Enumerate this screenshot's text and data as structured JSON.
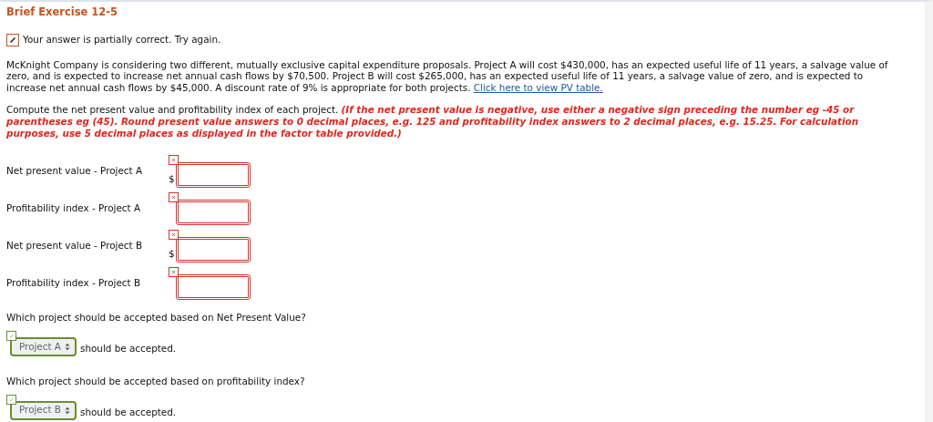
{
  "title": "Brief Exercise 12-5",
  "feedback": {
    "partial": true,
    "text": "Your answer is partially correct.  Try again."
  },
  "problem": {
    "text": "McKnight Company is considering two different, mutually exclusive capital expenditure proposals. Project A will cost $430,000, has an expected useful life of 11 years, a salvage value of zero, and is expected to increase net annual cash flows by $70,500. Project B will cost $265,000, has an expected useful life of 11 years, a salvage value of zero, and is expected to increase net annual cash flows by $45,000. A discount rate of 9% is appropriate for both projects.",
    "link": "Click here to view PV table."
  },
  "instruction": {
    "text": "Compute the net present value and profitability index of each project.",
    "note": "(If the net present value is negative, use either a negative sign preceding the number eg -45 or parentheses eg (45). Round present value answers to 0 decimal places, e.g. 125 and profitability index answers to 2 decimal places, e.g. 15.25. For calculation purposes, use 5 decimal places as displayed in the factor table provided.)"
  },
  "fields": [
    {
      "label": "Net present value - Project A",
      "prefix": "$",
      "correct": false
    },
    {
      "label": "Profitability index - Project A",
      "correct": false
    },
    {
      "label": "Net present value - Project B",
      "prefix": "$",
      "correct": false
    },
    {
      "label": "Profitability index - Project B",
      "correct": false
    }
  ],
  "questions": [
    {
      "question": "Which project should be accepted based on Net Present Value?",
      "value": "Project A",
      "correct": true,
      "suffix": "should be accepted."
    },
    {
      "question": "Which project should be accepted based on profitability index?",
      "value": "Project B",
      "correct": true,
      "suffix": "should be accepted."
    }
  ]
}
